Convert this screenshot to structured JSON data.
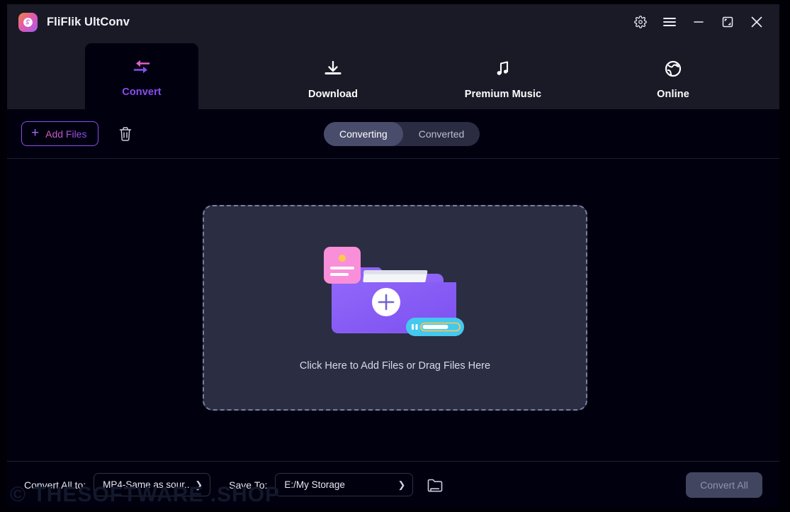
{
  "window": {
    "title": "FliFlik UltConv",
    "logo_icon": "app-logo-swirl-icon",
    "controls": [
      {
        "name": "settings-button",
        "icon": "gear-icon"
      },
      {
        "name": "menu-button",
        "icon": "hamburger-menu-icon"
      },
      {
        "name": "minimize-button",
        "icon": "minimize-icon"
      },
      {
        "name": "maximize-button",
        "icon": "maximize-restore-icon"
      },
      {
        "name": "close-button",
        "icon": "close-icon"
      }
    ]
  },
  "tabs": [
    {
      "id": "convert",
      "label": "Convert",
      "icon": "convert-arrows-icon",
      "active": true
    },
    {
      "id": "download",
      "label": "Download",
      "icon": "download-icon",
      "active": false
    },
    {
      "id": "premium",
      "label": "Premium Music",
      "icon": "music-note-icon",
      "active": false
    },
    {
      "id": "online",
      "label": "Online",
      "icon": "globe-icon",
      "active": false
    }
  ],
  "toolbar": {
    "add_files_label": "Add Files",
    "add_files_icon": "plus-icon",
    "delete_icon": "trash-icon",
    "segmented": {
      "options": [
        "Converting",
        "Converted"
      ],
      "selected": "Converting"
    }
  },
  "main": {
    "drop_zone_text": "Click Here to Add Files or Drag Files Here",
    "illustration": "folder-add-files-illustration"
  },
  "bottom_bar": {
    "convert_all_to_label": "Convert All to:",
    "format_value": "MP4-Same as sour...",
    "save_to_label": "Save To:",
    "path_value": "E:/My Storage",
    "browse_icon": "folder-icon",
    "chevron_icon": "chevron-right-icon",
    "convert_all_label": "Convert All",
    "convert_all_enabled": false
  },
  "watermark": {
    "text": "© THESOFTWARE .SHOP"
  },
  "colors": {
    "accent_purple": "#8b4df0",
    "accent_pink": "#e060b8",
    "titlebar_bg": "#191a26",
    "app_bg": "#00000f",
    "dropzone_bg": "#2b2d42",
    "segment_track": "#2a2c42",
    "segment_active": "#4a4c6b",
    "disabled_button": "#42455f"
  }
}
